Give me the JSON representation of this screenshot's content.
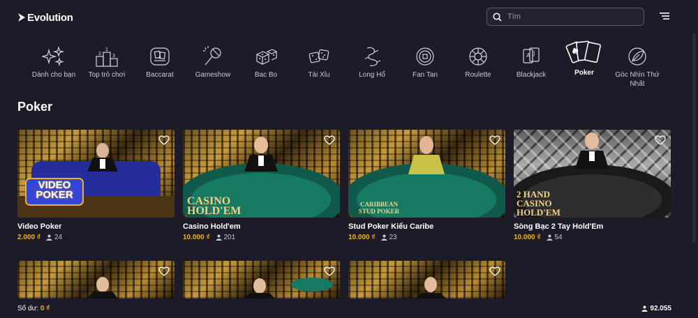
{
  "header": {
    "logo_text": "Evolution",
    "search_placeholder": "Tìm"
  },
  "categories": [
    {
      "label": "Dành cho bạn",
      "icon": "sparkles-icon"
    },
    {
      "label": "Top trò chơi",
      "icon": "podium-icon"
    },
    {
      "label": "Baccarat",
      "icon": "baccarat-icon"
    },
    {
      "label": "Gameshow",
      "icon": "microphone-icon"
    },
    {
      "label": "Bac Bo",
      "icon": "dice-icon"
    },
    {
      "label": "Tài Xỉu",
      "icon": "dice-pair-icon"
    },
    {
      "label": "Long Hổ",
      "icon": "dragon-icon"
    },
    {
      "label": "Fan Tan",
      "icon": "coin-icon"
    },
    {
      "label": "Roulette",
      "icon": "roulette-icon"
    },
    {
      "label": "Blackjack",
      "icon": "cards-icon"
    },
    {
      "label": "Poker",
      "icon": "poker-cards-icon",
      "active": true
    },
    {
      "label": "Góc Nhìn Thứ Nhất",
      "icon": "leaf-icon"
    }
  ],
  "section_title": "Poker",
  "games": [
    {
      "title": "Video Poker",
      "bet": "2.000 ₫",
      "players": "24",
      "overlay": "VIDEO POKER",
      "theme": "gold"
    },
    {
      "title": "Casino Hold'em",
      "bet": "10.000 ₫",
      "players": "201",
      "overlay": "CASINO HOLD'EM",
      "theme": "gold"
    },
    {
      "title": "Stud Poker Kiểu Caribe",
      "bet": "10.000 ₫",
      "players": "23",
      "overlay": "CARIBBEAN STUD POKER",
      "theme": "gold"
    },
    {
      "title": "Sòng Bạc 2 Tay Hold'Em",
      "bet": "10.000 ₫",
      "players": "54",
      "overlay": "2 HAND CASINO HOLD'EM",
      "theme": "silver"
    }
  ],
  "games_row2": [
    {
      "theme": "gold"
    },
    {
      "theme": "gold"
    },
    {
      "theme": "gold"
    }
  ],
  "footer": {
    "balance_label": "Số dư:",
    "balance_value": "0 ₫",
    "online_count": "92.055"
  },
  "colors": {
    "background": "#1c1b27",
    "accent_gold": "#f2b11e",
    "text_muted": "#c9c9d3"
  }
}
